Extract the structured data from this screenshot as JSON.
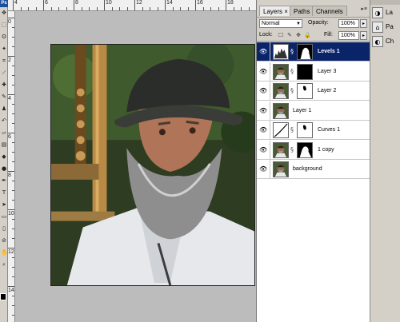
{
  "app": {
    "logo_text": "Ps"
  },
  "tools": [
    {
      "name": "move-tool-icon",
      "glyph": "✥"
    },
    {
      "name": "marquee-tool-icon",
      "glyph": "⬚"
    },
    {
      "name": "lasso-tool-icon",
      "glyph": "ʘ"
    },
    {
      "name": "magic-wand-tool-icon",
      "glyph": "✦"
    },
    {
      "name": "crop-tool-icon",
      "glyph": "⌗"
    },
    {
      "name": "slice-tool-icon",
      "glyph": "⟋"
    },
    {
      "name": "healing-brush-tool-icon",
      "glyph": "✚"
    },
    {
      "name": "brush-tool-icon",
      "glyph": "✎"
    },
    {
      "name": "clone-stamp-tool-icon",
      "glyph": "♟"
    },
    {
      "name": "history-brush-tool-icon",
      "glyph": "↶"
    },
    {
      "name": "eraser-tool-icon",
      "glyph": "▱"
    },
    {
      "name": "gradient-tool-icon",
      "glyph": "▤"
    },
    {
      "name": "blur-tool-icon",
      "glyph": "◆"
    },
    {
      "name": "dodge-tool-icon",
      "glyph": "●"
    },
    {
      "name": "pen-tool-icon",
      "glyph": "✒"
    },
    {
      "name": "type-tool-icon",
      "glyph": "T"
    },
    {
      "name": "path-selection-tool-icon",
      "glyph": "➤"
    },
    {
      "name": "shape-tool-icon",
      "glyph": "▭"
    },
    {
      "name": "notes-tool-icon",
      "glyph": "▯"
    },
    {
      "name": "eyedropper-tool-icon",
      "glyph": "⊘"
    },
    {
      "name": "hand-tool-icon",
      "glyph": "✋"
    },
    {
      "name": "zoom-tool-icon",
      "glyph": "⌕"
    }
  ],
  "ruler_top": [
    "4",
    "6",
    "8",
    "10",
    "12",
    "14",
    "16",
    "18"
  ],
  "ruler_left": [
    "0",
    "2",
    "4",
    "6",
    "8",
    "10",
    "12",
    "14"
  ],
  "layers_panel": {
    "tabs": [
      {
        "label": "Layers ×",
        "active": true
      },
      {
        "label": "Paths",
        "active": false
      },
      {
        "label": "Channels",
        "active": false
      }
    ],
    "menu_icon": "▸≡",
    "blend_mode": "Normal",
    "opacity_label": "Opacity:",
    "opacity_value": "100%",
    "lock_label": "Lock:",
    "lock_icons": [
      "☐",
      "✎",
      "✥",
      "🔒"
    ],
    "fill_label": "Fill:",
    "fill_value": "100%",
    "layers": [
      {
        "name": "Levels 1",
        "selected": true,
        "thumb": "levels",
        "mask": "mask-figure",
        "chain": true
      },
      {
        "name": "Layer 3",
        "selected": false,
        "thumb": "photo",
        "mask": "mask-black",
        "chain": true
      },
      {
        "name": "Layer 2",
        "selected": false,
        "thumb": "photo",
        "mask": "mask-white-blob",
        "chain": true
      },
      {
        "name": "Layer 1",
        "selected": false,
        "thumb": "photo",
        "mask": null,
        "chain": false
      },
      {
        "name": "Curves 1",
        "selected": false,
        "thumb": "curves",
        "mask": "mask-white-blob",
        "chain": true
      },
      {
        "name": "1 copy",
        "selected": false,
        "thumb": "photo",
        "mask": "mask-figure-white",
        "chain": true
      },
      {
        "name": "background",
        "selected": false,
        "thumb": "photo",
        "mask": null,
        "chain": false
      }
    ]
  },
  "dock": [
    {
      "icon": "◑",
      "label": "La",
      "name": "dock-layers"
    },
    {
      "icon": "⌂",
      "label": "Pa",
      "name": "dock-paths"
    },
    {
      "icon": "◐",
      "label": "Ch",
      "name": "dock-channels"
    }
  ]
}
